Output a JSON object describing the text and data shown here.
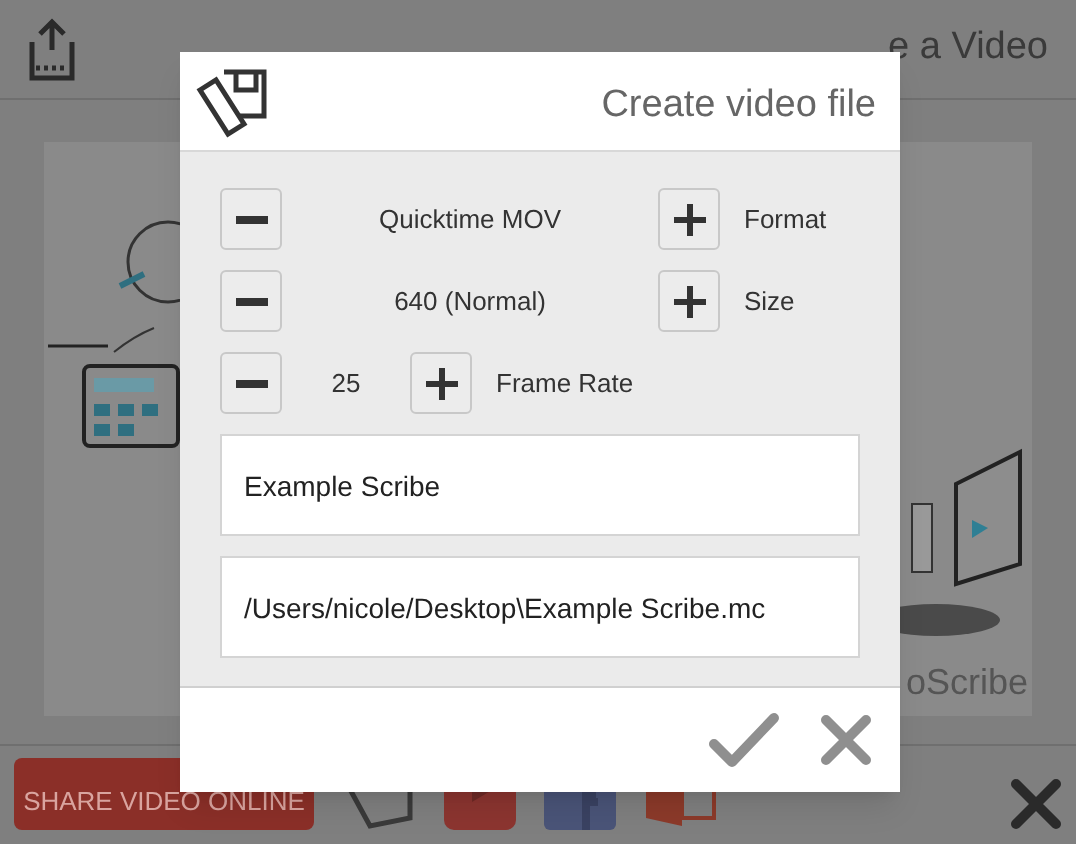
{
  "app": {
    "title": "e a Video",
    "logo_text": "oScribe"
  },
  "dialog": {
    "title": "Create video file",
    "options": [
      {
        "kind": "wide",
        "value": "Quicktime MOV",
        "label": "Format"
      },
      {
        "kind": "wide",
        "value": "640 (Normal)",
        "label": "Size"
      },
      {
        "kind": "narrow",
        "value": "25",
        "label": "Frame Rate"
      }
    ],
    "fields": [
      {
        "value": "Example Scribe"
      },
      {
        "value": "/Users/nicole/Desktop\\Example Scribe.mc"
      }
    ]
  },
  "bottom_bar": {
    "share_button": "SHARE VIDEO ONLINE"
  }
}
